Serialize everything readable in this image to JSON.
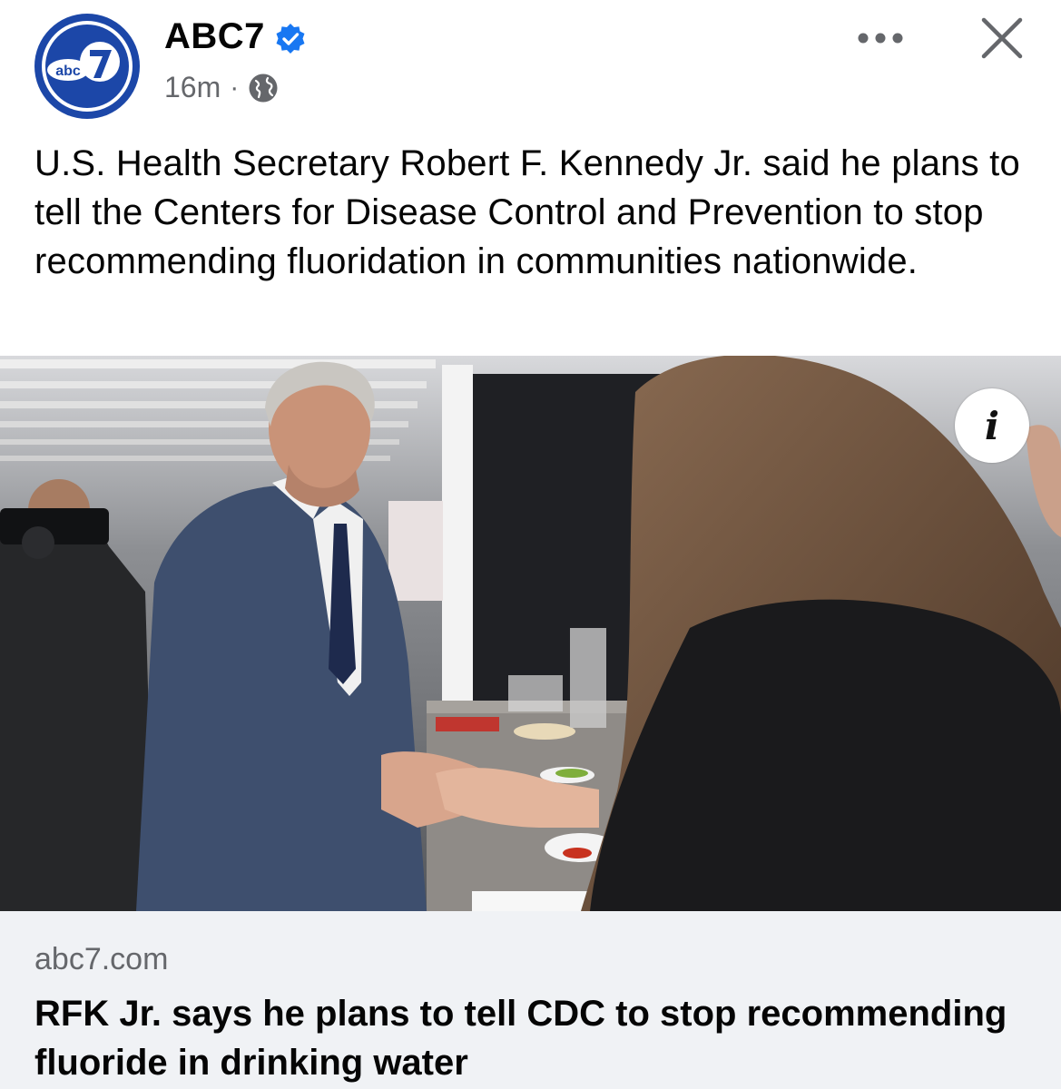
{
  "post": {
    "page_name": "ABC7",
    "avatar_text": "abc7",
    "timestamp": "16m",
    "separator": "·",
    "audience_icon": "globe-icon",
    "verified_icon": "verified-badge-icon",
    "more_icon": "more-options-icon",
    "close_icon": "close-icon",
    "caption": "U.S. Health Secretary Robert F. Kennedy Jr. said he plans to tell the Centers for Disease Control and Prevention to stop recommending fluoridation in communities nationwide."
  },
  "media": {
    "info_icon": "info-icon",
    "info_glyph": "i"
  },
  "link_preview": {
    "domain": "abc7.com",
    "title": "RFK Jr. says he plans to tell CDC to stop recommending fluoride in drinking water"
  },
  "colors": {
    "abc_blue": "#1c47a8",
    "verified_blue": "#1877f2",
    "secondary_text": "#65676b",
    "preview_bg": "#f0f2f5"
  }
}
